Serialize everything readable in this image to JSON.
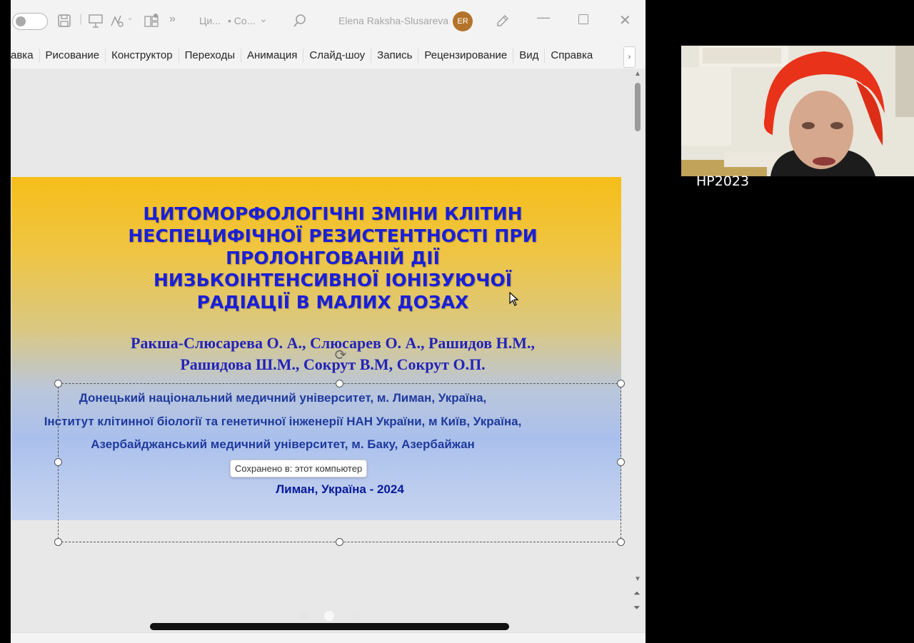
{
  "titlebar": {
    "filename": "Ци...",
    "status": "• Со...",
    "user_name": "Elena Raksha-Slusareva",
    "user_initials": "ER"
  },
  "ribbon": {
    "tabs": [
      {
        "label": "авка"
      },
      {
        "label": "Рисование"
      },
      {
        "label": "Конструктор"
      },
      {
        "label": "Переходы"
      },
      {
        "label": "Анимация"
      },
      {
        "label": "Слайд-шоу"
      },
      {
        "label": "Запись"
      },
      {
        "label": "Рецензирование"
      },
      {
        "label": "Вид"
      },
      {
        "label": "Справка"
      }
    ]
  },
  "slide": {
    "title_lines": [
      "ЦИТОМОРФОЛОГІЧНІ ЗМІНИ КЛІТИН",
      "НЕСПЕЦИФІЧНОЇ РЕЗИСТЕНТНОСТІ ПРИ",
      "ПРОЛОНГОВАНІЙ ДІЇ",
      "НИЗЬКОІНТЕНСИВНОЇ ІОНІЗУЮЧОЇ",
      "РАДІАЦІЇ В МАЛИХ ДОЗАХ"
    ],
    "authors_lines": [
      "Ракша-Слюсарева О. А., Слюсарев О. А., Рашидов Н.М.,",
      "Рашидова Ш.М., Сокрут В.М,  Сокрут О.П."
    ],
    "affiliations": [
      "Донецький національний медичний університет, м. Лиман, Україна,",
      "Інститут клітинної біології та генетичної інженерії НАН України, м Київ, Україна,",
      "Азербайджанський медичний університет, м. Баку, Азербайжан"
    ],
    "place_year": "Лиман, Україна - 2024",
    "colors": {
      "title": "#1a1fd8",
      "authors": "#2424b8",
      "affiliation": "#1f3a9e",
      "gradient_top": "#f5be1a",
      "gradient_bottom": "#c7d4f0"
    }
  },
  "tooltip": {
    "saved": "Сохранено в: этот компьютер"
  },
  "video": {
    "participant_name": "HP2023"
  },
  "icons": [
    "autosave-toggle",
    "save-icon",
    "present-icon",
    "draw-icon",
    "layout-icon",
    "search-icon",
    "pen-icon",
    "minimize-icon",
    "maximize-icon",
    "close-icon"
  ]
}
